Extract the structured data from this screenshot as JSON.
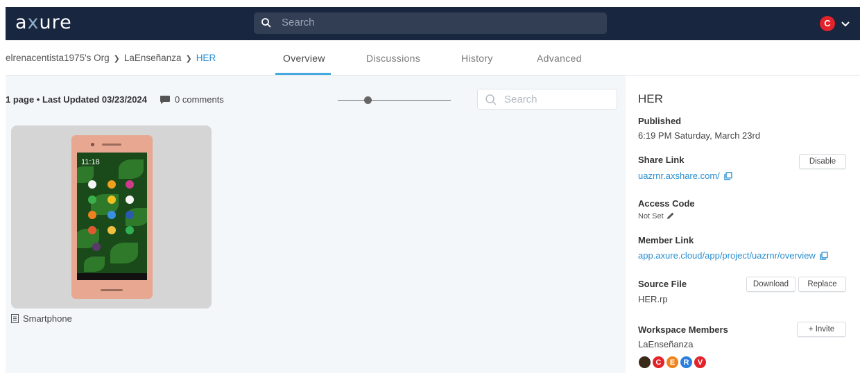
{
  "app": {
    "logo_prefix": "a",
    "logo_x": "x",
    "logo_suffix": "ure",
    "search_placeholder": "Search",
    "user_initial": "C",
    "accent": "#2a8fd0",
    "topbar_color": "#182640"
  },
  "breadcrumb": {
    "items": [
      "elrenacentista1975's Org",
      "LaEnseñanza",
      "HER"
    ]
  },
  "tabs": [
    {
      "label": "Overview",
      "active": true
    },
    {
      "label": "Discussions",
      "active": false
    },
    {
      "label": "History",
      "active": false
    },
    {
      "label": "Advanced",
      "active": false
    }
  ],
  "main": {
    "meta": "1 page • Last Updated 03/23/2024",
    "comments": "0 comments",
    "search_placeholder": "Search",
    "page_name": "Smartphone",
    "phone_clock": "11:18"
  },
  "panel": {
    "title": "HER",
    "published_label": "Published",
    "published_value": "6:19 PM Saturday, March 23rd",
    "share_label": "Share Link",
    "share_value": "uazrnr.axshare.com/",
    "disable_button": "Disable",
    "access_label": "Access Code",
    "access_value": "Not Set",
    "member_label": "Member Link",
    "member_value": "app.axure.cloud/app/project/uazrnr/overview",
    "source_label": "Source File",
    "source_value": "HER.rp",
    "download_button": "Download",
    "replace_button": "Replace",
    "workspace_label": "Workspace Members",
    "workspace_value": "LaEnseñanza",
    "invite_button": "+ Invite",
    "members": [
      {
        "initial": "",
        "color": "#3a2a1a"
      },
      {
        "initial": "C",
        "color": "#e2232a"
      },
      {
        "initial": "E",
        "color": "#f0841c"
      },
      {
        "initial": "R",
        "color": "#2a7ee0"
      },
      {
        "initial": "V",
        "color": "#e2232a"
      }
    ]
  }
}
